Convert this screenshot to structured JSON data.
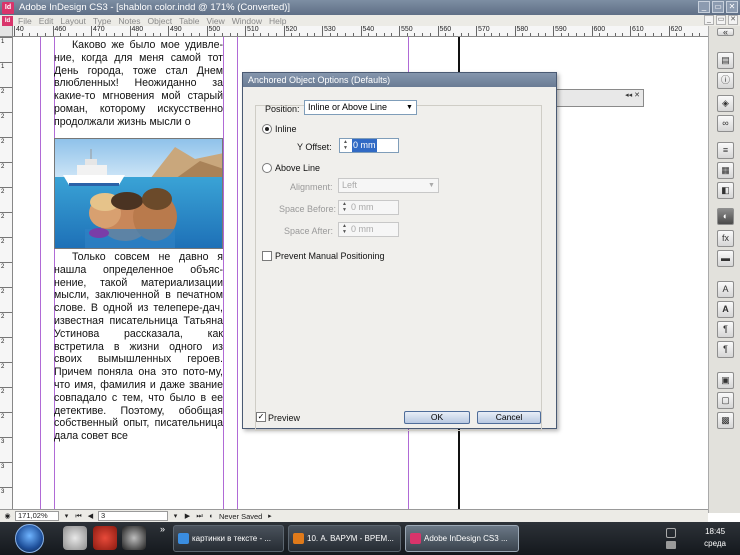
{
  "window": {
    "title": "Adobe InDesign CS3 - [shablon color.indd @ 171% (Converted)]",
    "app_badge": "Id",
    "controls": [
      "_",
      "▭",
      "✕"
    ]
  },
  "menubar": {
    "items": [
      "File",
      "Edit",
      "Layout",
      "Type",
      "Notes",
      "Object",
      "Table",
      "View",
      "Window",
      "Help"
    ]
  },
  "ruler": {
    "h_labels": [
      "40",
      "460",
      "470",
      "480",
      "490",
      "500",
      "510",
      "520",
      "530",
      "540",
      "550",
      "560",
      "570",
      "580",
      "590",
      "600",
      "610",
      "620"
    ],
    "v_labels": [
      "1",
      "1",
      "2",
      "2",
      "2",
      "2",
      "2",
      "2",
      "2",
      "2",
      "2",
      "2",
      "2",
      "2",
      "2",
      "2",
      "3",
      "3",
      "3"
    ]
  },
  "document": {
    "paragraph1": "Каково же было мое удивле-ние, когда для меня самой тот День города, тоже стал Днем влюбленных! Неожиданно за какие-то мгновения мой старый роман, которому искусственно продолжали жизнь мысли о",
    "paragraph2": "Только совсем не давно я нашла определенное объяс-нение, такой материализации мысли, заключенной в печатном слове. В одной из телепере-дач, известная писательница Татьяна Устинова рассказала, как встретила в жизни одного из своих вымышленных героев. Причем поняла она это пото-му, что имя, фамилия и даже звание совпадало с тем, что было в ее детективе. Поэтому, обобщая собственный опыт, писательница дала совет все"
  },
  "dialog": {
    "title": "Anchored Object Options (Defaults)",
    "position_label": "Position:",
    "position_value": "Inline or Above Line",
    "inline_label": "Inline",
    "y_offset_label": "Y Offset:",
    "y_offset_value": "0 mm",
    "above_line_label": "Above Line",
    "alignment_label": "Alignment:",
    "alignment_value": "Left",
    "space_before_label": "Space Before:",
    "space_before_value": "0 mm",
    "space_after_label": "Space After:",
    "space_after_value": "0 mm",
    "prevent_label": "Prevent Manual Positioning",
    "preview_label": "Preview",
    "ok_label": "OK",
    "cancel_label": "Cancel",
    "inline_selected": true,
    "preview_checked": true,
    "prevent_checked": false
  },
  "palette": {
    "controls": "◂◂ ✕"
  },
  "statusbar": {
    "zoom": "171,02%",
    "page": "3",
    "status": "Never Saved"
  },
  "taskbar": {
    "items": [
      {
        "label": "картинки в тексте - ...",
        "icon": "ie-icon",
        "color": "#3a8de0"
      },
      {
        "label": "10. А. ВАРУМ - ВРЕМ...",
        "icon": "winamp-icon",
        "color": "#e07a1a"
      },
      {
        "label": "Adobe InDesign CS3 ...",
        "icon": "indesign-icon",
        "color": "#d9346b"
      }
    ],
    "time": "18:45",
    "day": "среда",
    "overflow": "»"
  },
  "colors": {
    "accent": "#316ac5",
    "guide": "#b06ad6",
    "indesign": "#d9346b"
  }
}
